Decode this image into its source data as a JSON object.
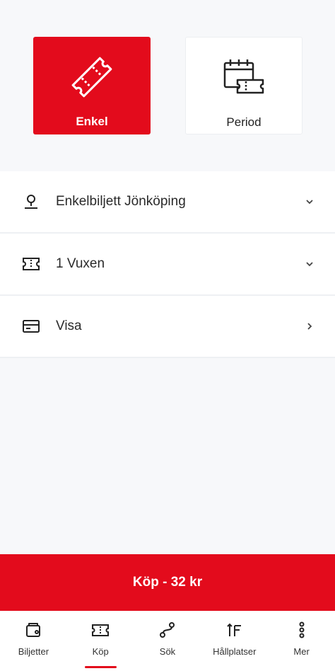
{
  "ticket_types": {
    "single": {
      "label": "Enkel",
      "icon": "ticket-icon",
      "selected": true
    },
    "period": {
      "label": "Period",
      "icon": "calendar-ticket-icon",
      "selected": false
    }
  },
  "options": [
    {
      "label": "Enkelbiljett Jönköping",
      "icon": "location-pin-icon",
      "action": "chevron-down-icon"
    },
    {
      "label": "1 Vuxen",
      "icon": "ticket-outline-icon",
      "action": "chevron-down-icon"
    },
    {
      "label": "Visa",
      "icon": "card-icon",
      "action": "chevron-right-icon"
    }
  ],
  "buy": {
    "label": "Köp - 32 kr"
  },
  "nav": [
    {
      "label": "Biljetter",
      "icon": "tickets-icon",
      "active": false
    },
    {
      "label": "Köp",
      "icon": "buy-ticket-icon",
      "active": true
    },
    {
      "label": "Sök",
      "icon": "route-icon",
      "active": false
    },
    {
      "label": "Hållplatser",
      "icon": "stops-icon",
      "active": false
    },
    {
      "label": "Mer",
      "icon": "more-icon",
      "active": false
    }
  ],
  "colors": {
    "accent": "#e30b1c",
    "background": "#f7f8fa",
    "surface": "#ffffff",
    "text": "#222222"
  }
}
